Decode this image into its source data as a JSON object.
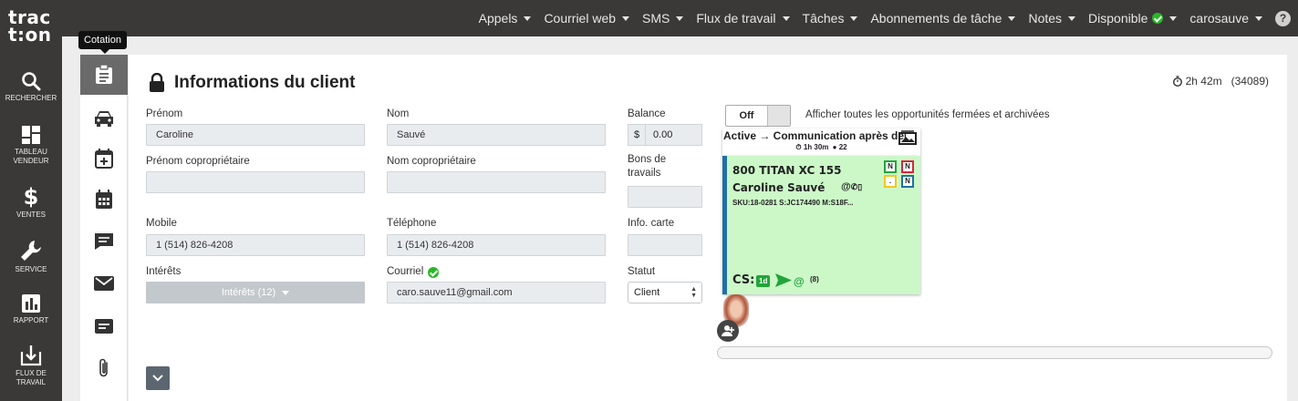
{
  "brand": {
    "line1": "trac",
    "line2": "t:on"
  },
  "topnav": {
    "items": [
      "Appels",
      "Courriel web",
      "SMS",
      "Flux de travail",
      "Tâches",
      "Abonnements de tâche",
      "Notes"
    ],
    "availability": "Disponible",
    "user": "carosauve",
    "help": "?"
  },
  "sidebar": {
    "items": [
      {
        "label": "RECHERCHER",
        "icon": "search-icon"
      },
      {
        "label": "TABLEAU VENDEUR",
        "icon": "dashboard-icon"
      },
      {
        "label": "VENTES",
        "icon": "dollar-icon"
      },
      {
        "label": "SERVICE",
        "icon": "wrench-icon"
      },
      {
        "label": "RAPPORT",
        "icon": "report-icon"
      },
      {
        "label": "FLUX DE TRAVAIL",
        "icon": "download-icon"
      }
    ]
  },
  "tooltip": "Cotation",
  "iconcol": [
    "clipboard-icon",
    "car-icon",
    "calendar-plus-icon",
    "calendar-icon",
    "chat-icon",
    "mail-icon",
    "note-icon",
    "paperclip-icon"
  ],
  "panel": {
    "title": "Informations du client",
    "timer": "2h 42m",
    "lead_id": "(34089)"
  },
  "form": {
    "prenom_label": "Prénom",
    "prenom_value": "Caroline",
    "nom_label": "Nom",
    "nom_value": "Sauvé",
    "balance_label": "Balance",
    "balance_currency": "$",
    "balance_value": "0.00",
    "coprenom_label": "Prénom copropriétaire",
    "conom_label": "Nom copropriétaire",
    "bons_label": "Bons de travails",
    "mobile_label": "Mobile",
    "mobile_value": "1 (514) 826-4208",
    "tel_label": "Téléphone",
    "tel_value": "1 (514) 826-4208",
    "infocarte_label": "Info. carte",
    "interets_label": "Intérêts",
    "interets_button": "Intérêts (12)",
    "courriel_label": "Courriel",
    "courriel_value": "caro.sauve11@gmail.com",
    "statut_label": "Statut",
    "statut_value": "Client"
  },
  "opportunities": {
    "toggle_state": "Off",
    "toggle_label": "Afficher toutes les opportunités fermées et archivées"
  },
  "card": {
    "header": "Active → Communication après deuxi",
    "meta_time": "1h 30m",
    "meta_count": "22",
    "vehicle": "800 TITAN XC 155",
    "client": "Caroline Sauvé",
    "sku": "SKU:18-0281 S:JC174490 M:S18F...",
    "cs": "CS:",
    "cs_tag": "1d",
    "cs_count": "(8)",
    "badge_n1": "N",
    "badge_n2": "N",
    "badge_dot": ".",
    "badge_n3": "N",
    "colors": {
      "green": "#22a53a",
      "red": "#d9253a",
      "yellow": "#f3c623",
      "blue": "#1f6fa7",
      "card_bg": "#ccf8c8"
    }
  },
  "progress": {
    "value": 0
  }
}
